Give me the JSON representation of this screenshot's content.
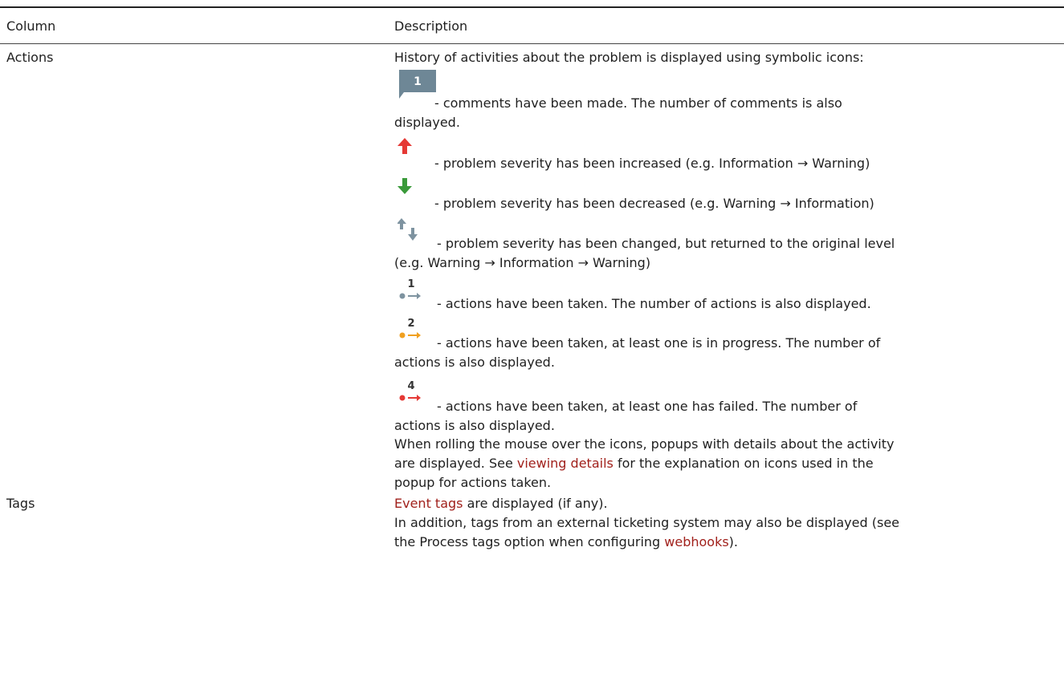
{
  "table": {
    "headers": {
      "column": "Column",
      "description": "Description"
    },
    "actions": {
      "name": "Actions",
      "intro": "History of activities about the problem is displayed using symbolic icons:",
      "comment_badge": "1",
      "comments_line1": " - comments have been made. The number of comments is also",
      "comments_line2": "displayed.",
      "increased": " - problem severity has been increased (e.g. Information → Warning)",
      "decreased": " - problem severity has been decreased (e.g. Warning → Information)",
      "changed_line1": " - problem severity has been changed, but returned to the original level",
      "changed_line2": "(e.g. Warning → Information → Warning)",
      "taken_count": "1",
      "taken": " - actions have been taken. The number of actions is also displayed.",
      "progress_count": "2",
      "progress_line1": " - actions have been taken, at least one is in progress. The number of",
      "progress_line2": "actions is also displayed.",
      "failed_count": "4",
      "failed_line1": " - actions have been taken, at least one has failed. The number of",
      "failed_line2": "actions is also displayed.",
      "hover_line1": "When rolling the mouse over the icons, popups with details about the activity",
      "hover_line2_pre": "are displayed. See ",
      "hover_link": "viewing details",
      "hover_line2_post": " for the explanation on icons used in the",
      "hover_line3": "popup for actions taken."
    },
    "tags": {
      "name": "Tags",
      "link": "Event tags",
      "line1_post": " are displayed (if any).",
      "line2": "In addition, tags from an external ticketing system may also be displayed (see",
      "line3_pre": "the Process tags option when configuring ",
      "line3_link": "webhooks",
      "line3_post": ")."
    }
  },
  "colors": {
    "link": "#a1211c",
    "comment_badge": "#6e8796",
    "arrow_up": "#e53935",
    "arrow_down": "#3a9a3a",
    "arrow_neutral": "#7e93a0",
    "action_taken": "#7e93a0",
    "action_progress": "#f0a020",
    "action_failed": "#e53935"
  }
}
